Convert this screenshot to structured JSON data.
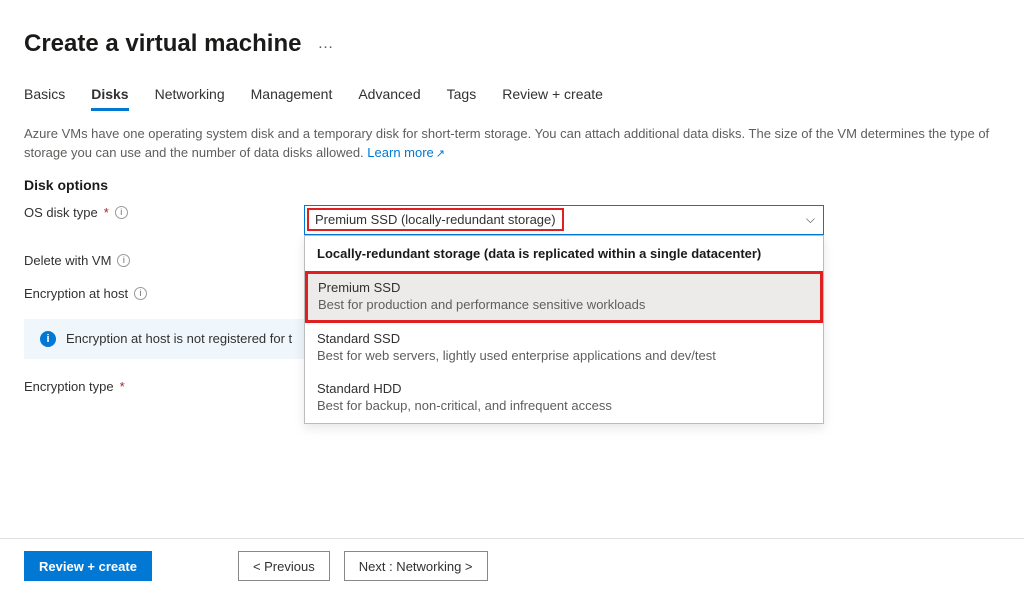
{
  "header": {
    "title": "Create a virtual machine",
    "more": "…"
  },
  "tabs": [
    {
      "label": "Basics"
    },
    {
      "label": "Disks"
    },
    {
      "label": "Networking"
    },
    {
      "label": "Management"
    },
    {
      "label": "Advanced"
    },
    {
      "label": "Tags"
    },
    {
      "label": "Review + create"
    }
  ],
  "intro": {
    "text": "Azure VMs have one operating system disk and a temporary disk for short-term storage. You can attach additional data disks. The size of the VM determines the type of storage you can use and the number of data disks allowed.",
    "learn_more": "Learn more"
  },
  "disk_options": {
    "section_title": "Disk options",
    "os_disk_type_label": "OS disk type",
    "os_disk_type_value": "Premium SSD (locally-redundant storage)",
    "delete_with_vm_label": "Delete with VM",
    "encryption_at_host_label": "Encryption at host",
    "encryption_type_label": "Encryption type"
  },
  "dropdown": {
    "group_header": "Locally-redundant storage (data is replicated within a single datacenter)",
    "options": [
      {
        "title": "Premium SSD",
        "desc": "Best for production and performance sensitive workloads"
      },
      {
        "title": "Standard SSD",
        "desc": "Best for web servers, lightly used enterprise applications and dev/test"
      },
      {
        "title": "Standard HDD",
        "desc": "Best for backup, non-critical, and infrequent access"
      }
    ]
  },
  "banner": {
    "text": "Encryption at host is not registered for t"
  },
  "footer": {
    "review": "Review + create",
    "previous": "< Previous",
    "next": "Next : Networking >"
  }
}
